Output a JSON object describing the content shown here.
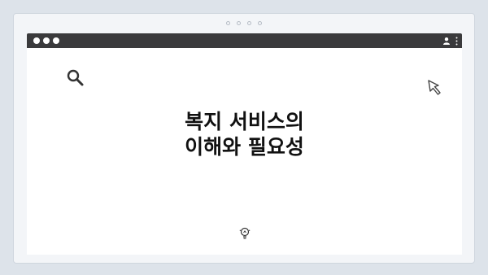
{
  "title": {
    "line1": "복지 서비스의",
    "line2": "이해와 필요성"
  },
  "icons": {
    "search": "search-icon",
    "cursor": "cursor-icon",
    "user": "user-icon",
    "menu": "kebab-menu-icon",
    "bulb": "lightbulb-icon"
  },
  "colors": {
    "page_background": "#dde3ea",
    "browser_bar": "#3a3a3c",
    "content_background": "#ffffff",
    "title_text": "#111111"
  }
}
